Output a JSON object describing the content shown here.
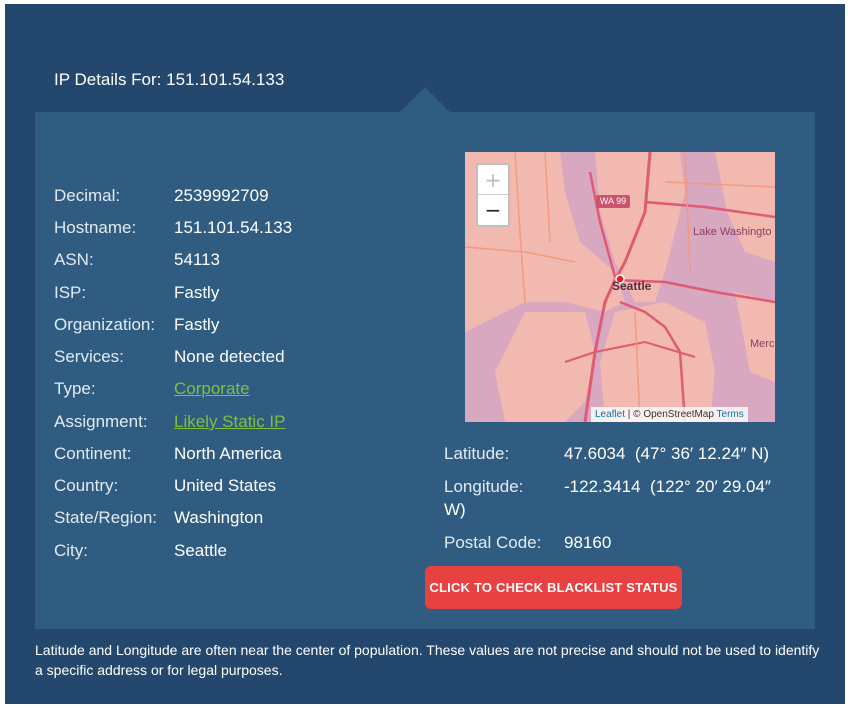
{
  "header": {
    "title": "IP Details For: 151.101.54.133"
  },
  "details": [
    {
      "label": "Decimal:",
      "value": "2539992709",
      "link": false
    },
    {
      "label": "Hostname:",
      "value": "151.101.54.133",
      "link": false
    },
    {
      "label": "ASN:",
      "value": "54113",
      "link": false
    },
    {
      "label": "ISP:",
      "value": "Fastly",
      "link": false
    },
    {
      "label": "Organization:",
      "value": "Fastly",
      "link": false
    },
    {
      "label": "Services:",
      "value": "None detected",
      "link": false
    },
    {
      "label": "Type:",
      "value": "Corporate",
      "link": true
    },
    {
      "label": "Assignment:",
      "value": "Likely Static IP",
      "link": true
    },
    {
      "label": "Continent:",
      "value": "North America",
      "link": false
    },
    {
      "label": "Country:",
      "value": "United States",
      "link": false
    },
    {
      "label": "State/Region:",
      "value": "Washington",
      "link": false
    },
    {
      "label": "City:",
      "value": "Seattle",
      "link": false
    }
  ],
  "geo": {
    "latitude_label": "Latitude:",
    "latitude_value": "47.6034  (47° 36′ 12.24″ N)",
    "longitude_label": "Longitude:",
    "longitude_value": "-122.3414  (122° 20′ 29.04″",
    "longitude_value_cont": "W)",
    "postal_label": "Postal Code:",
    "postal_value": "98160"
  },
  "map": {
    "zoom_in": "+",
    "zoom_out": "−",
    "labels": {
      "city": "Seattle",
      "lake": "Lake Washingto",
      "route": "WA 99",
      "mercer": "Merc"
    },
    "attribution_leaflet": "Leaflet",
    "attribution_sep": " | © OpenStreetMap ",
    "attribution_terms": "Terms"
  },
  "button": {
    "label": "CLICK TO CHECK BLACKLIST STATUS"
  },
  "footer": {
    "note": "Latitude and Longitude are often near the center of population. These values are not precise and should not be used to identify a specific address or for legal purposes."
  },
  "colors": {
    "background": "#24476e",
    "panel": "#2f5c80",
    "link": "#7cc142",
    "button": "#e84142"
  }
}
